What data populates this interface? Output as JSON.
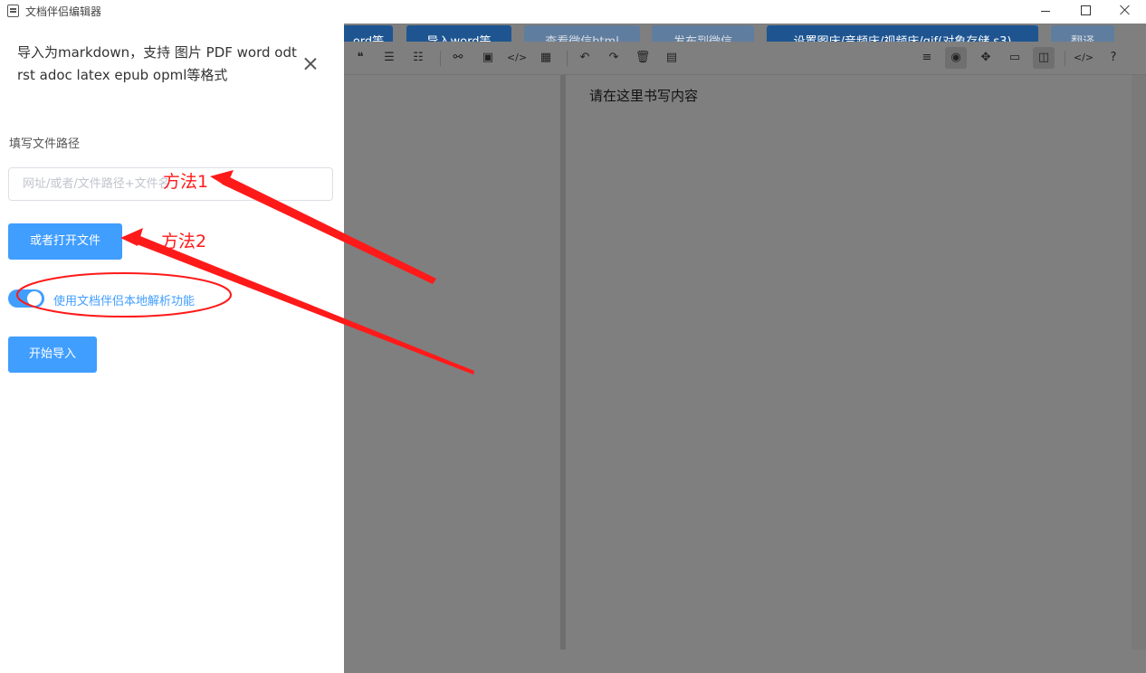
{
  "window": {
    "title": "文档伴侣编辑器"
  },
  "topbar": {
    "import_md": "ord等",
    "import_word": "导入word等",
    "view_html": "查看微信html",
    "publish": "发布到微信",
    "settings": "设置图床/音频床/视频床/gif(对象存储 s3)",
    "translate": "翻译"
  },
  "toolbar": {
    "icons": [
      "quote-icon",
      "ordered-list-icon",
      "unordered-list-icon",
      "link-icon",
      "image-icon",
      "code-icon",
      "table-icon",
      "undo-icon",
      "redo-icon",
      "trash-icon",
      "save-icon",
      "menu-icon",
      "preview-eye-icon",
      "fullscreen-icon",
      "window-icon",
      "split-view-icon",
      "source-code-icon",
      "help-icon"
    ]
  },
  "preview": {
    "placeholder": "请在这里书写内容"
  },
  "drawer": {
    "title": "导入为markdown，支持 图片 PDF word odt rst adoc latex epub opml等格式",
    "path_label": "填写文件路径",
    "path_placeholder": "网址/或者/文件路径+文件名",
    "open_file_label": "或者打开文件",
    "local_parse_label": "使用文档伴侣本地解析功能",
    "local_parse_on": true,
    "start_import_label": "开始导入"
  },
  "annotations": {
    "method1": "方法1",
    "method2": "方法2"
  },
  "colors": {
    "primary": "#409eff",
    "dark_blue": "#1e5591",
    "annotation_red": "#ff1a1a"
  }
}
